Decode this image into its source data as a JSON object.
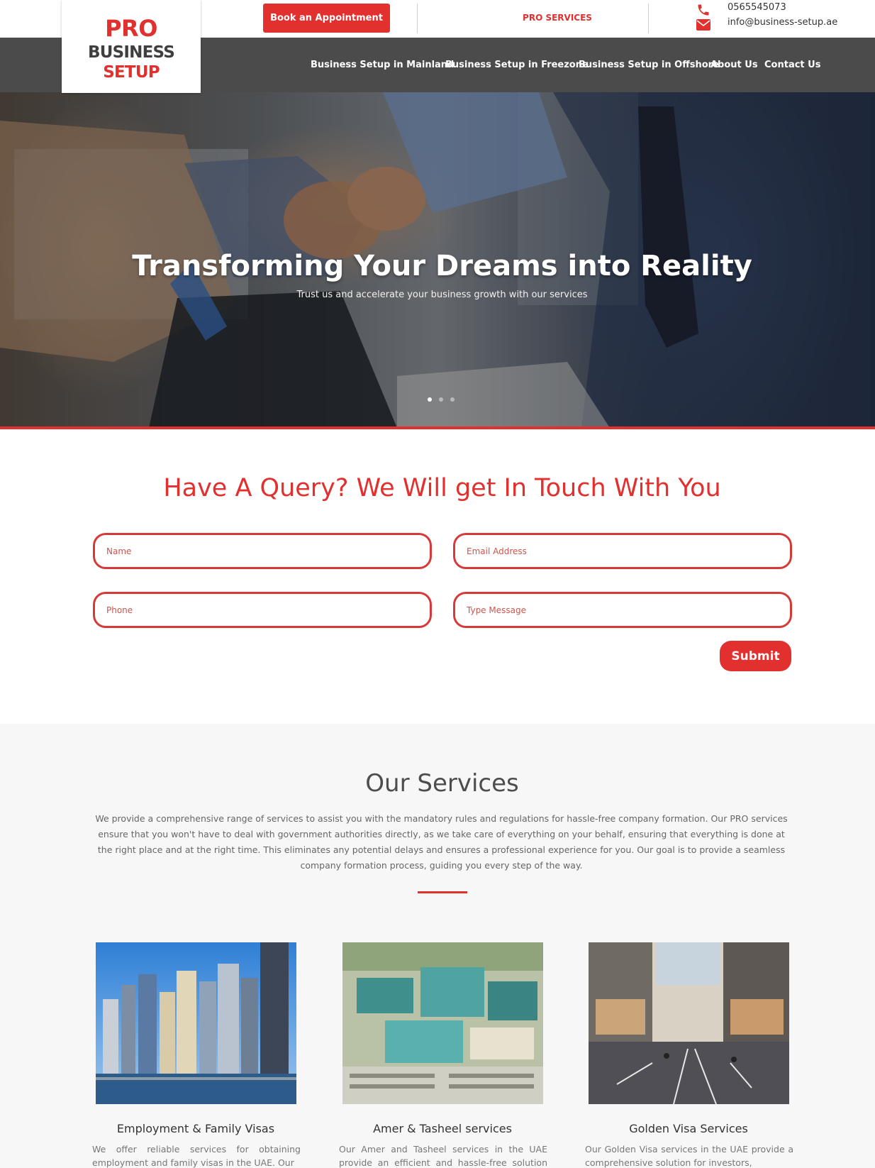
{
  "header": {
    "logo": {
      "line1": "PRO",
      "line2a": "BUSINESS",
      "line2b": "SETUP"
    },
    "book_label": "Book an Appointment",
    "pro_services_label": "PRO SERVICES",
    "phone": "0565545073",
    "email": "info@business-setup.ae"
  },
  "nav": {
    "items": [
      {
        "label": "Business Setup in Mainland"
      },
      {
        "label": "Business Setup in Freezone"
      },
      {
        "label": "Business Setup in Offshore"
      },
      {
        "label": "About Us"
      },
      {
        "label": "Contact Us"
      }
    ]
  },
  "hero": {
    "title": "Transforming Your Dreams into Reality",
    "subtitle": "Trust us and accelerate your business growth with our services"
  },
  "query": {
    "title": "Have A Query? We Will get In Touch With You",
    "name_placeholder": "Name",
    "email_placeholder": "Email Address",
    "phone_placeholder": "Phone",
    "message_placeholder": "Type Message",
    "submit_label": "Submit"
  },
  "services": {
    "title": "Our Services",
    "description": "We provide a comprehensive range of services to assist you with the mandatory rules and regulations for hassle-free company formation. Our PRO services ensure that you won't have to deal with government authorities directly, as we take care of everything on your behalf, ensuring that everything is done at the right place and at the right time. This eliminates any potential delays and ensures a professional experience for you. Our goal is to provide a seamless company formation process, guiding you every step of the way.",
    "cards": [
      {
        "title": "Employment & Family Visas",
        "text": "We offer reliable services for obtaining employment and family visas in the UAE. Our"
      },
      {
        "title": "Amer & Tasheel services",
        "text": "Our Amer and Tasheel services in the UAE provide an efficient and hassle-free solution for"
      },
      {
        "title": "Golden Visa Services",
        "text": "Our Golden Visa services in the UAE provide a comprehensive solution for investors,"
      }
    ]
  },
  "colors": {
    "accent": "#e2302f",
    "nav_bg": "#4b4b4b",
    "section_bg": "#f7f7f7"
  }
}
